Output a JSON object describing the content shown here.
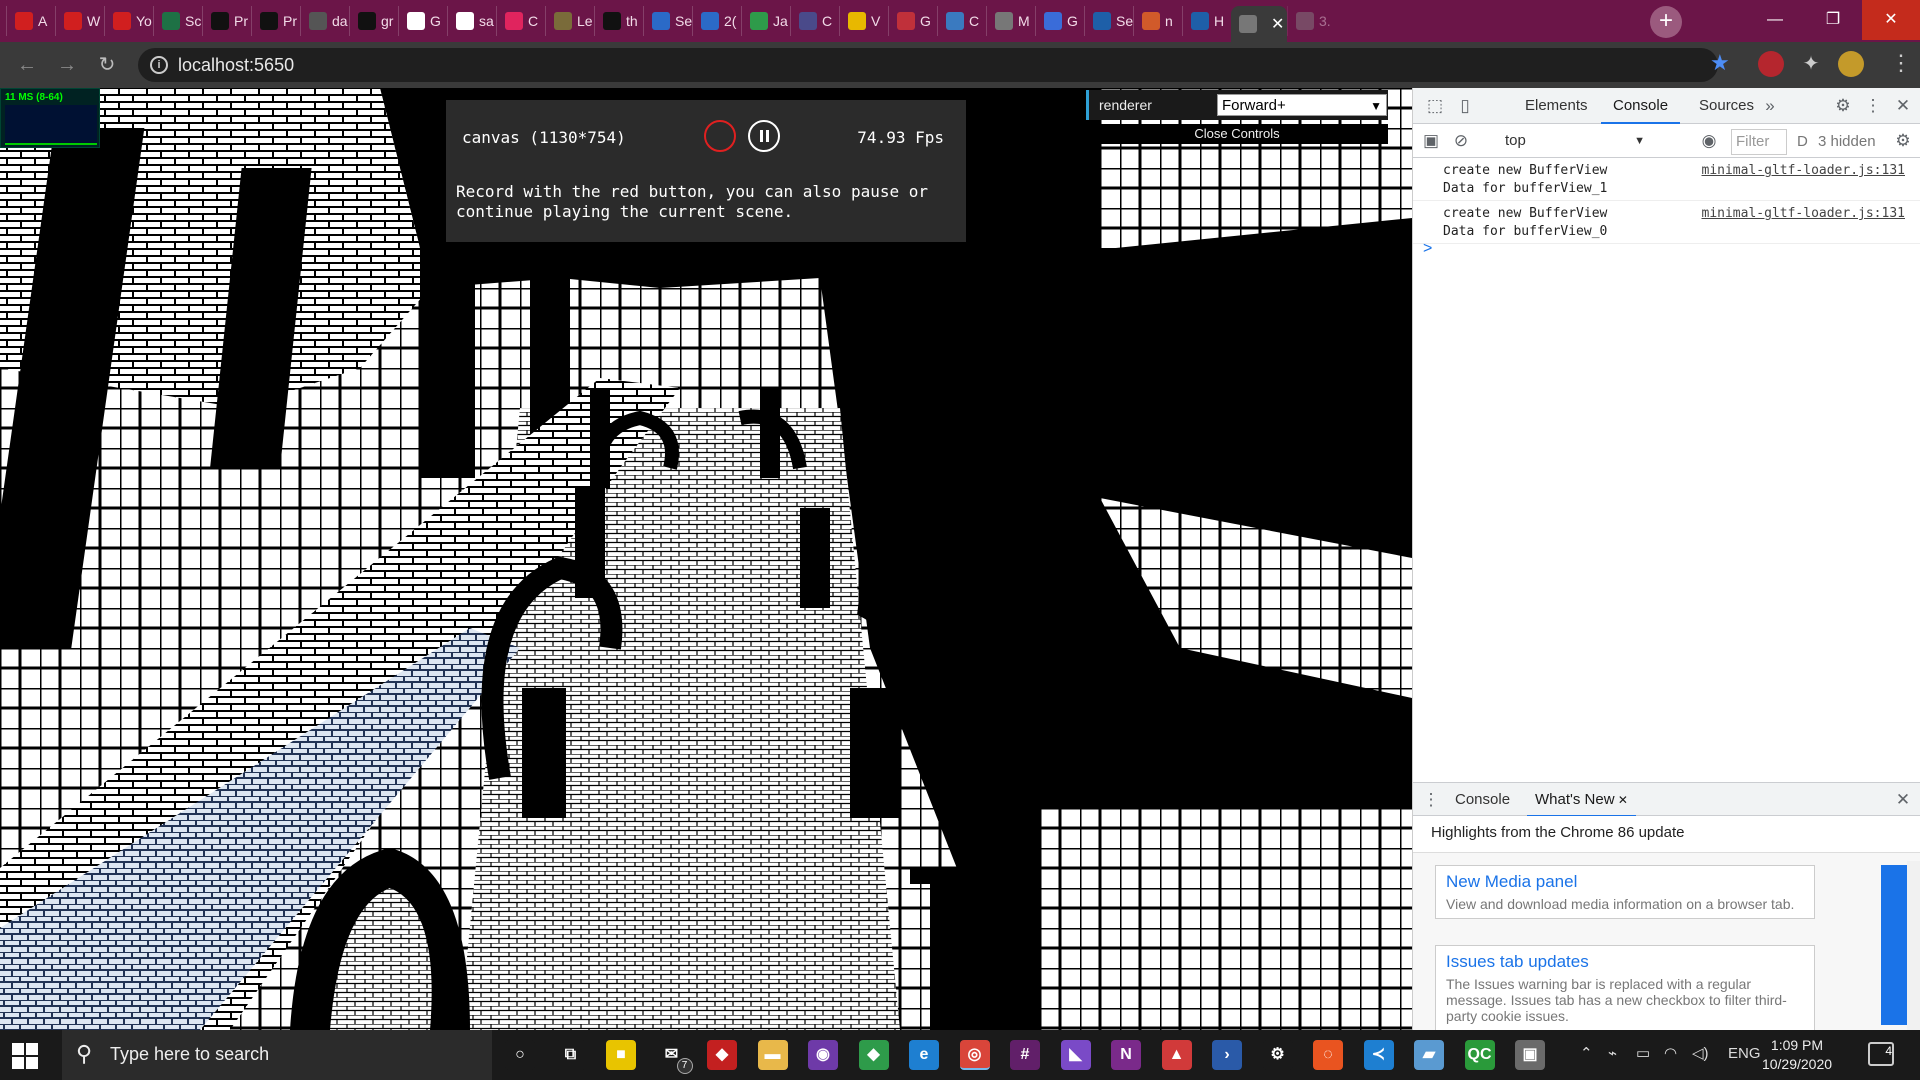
{
  "browser": {
    "tabs": [
      {
        "label": "A",
        "fav": "maple-leaf",
        "color": "#d11f1f"
      },
      {
        "label": "W",
        "fav": "maple-leaf",
        "color": "#d11f1f"
      },
      {
        "label": "Yo",
        "fav": "maple-leaf",
        "color": "#d11f1f"
      },
      {
        "label": "Sc",
        "fav": "excel",
        "color": "#1e7145"
      },
      {
        "label": "Pr",
        "fav": "github",
        "color": "#111111"
      },
      {
        "label": "Pr",
        "fav": "github",
        "color": "#111111"
      },
      {
        "label": "da",
        "fav": "globe",
        "color": "#555555"
      },
      {
        "label": "gr",
        "fav": "github",
        "color": "#111111"
      },
      {
        "label": "G",
        "fav": "google",
        "color": "#ffffff"
      },
      {
        "label": "sa",
        "fav": "google",
        "color": "#ffffff"
      },
      {
        "label": "C",
        "fav": "red-ring",
        "color": "#e0245e"
      },
      {
        "label": "Le",
        "fav": "s-stamp",
        "color": "#7a6b3a"
      },
      {
        "label": "th",
        "fav": "github",
        "color": "#111111"
      },
      {
        "label": "Se",
        "fav": "w-word",
        "color": "#2b6ac7"
      },
      {
        "label": "2(",
        "fav": "w-word",
        "color": "#2b6ac7"
      },
      {
        "label": "Ja",
        "fav": "green-box",
        "color": "#2e9b4a"
      },
      {
        "label": "C",
        "fav": "compass",
        "color": "#4a4a8a"
      },
      {
        "label": "V",
        "fav": "yellow-box",
        "color": "#e8b800"
      },
      {
        "label": "G",
        "fav": "p-red",
        "color": "#c0303a"
      },
      {
        "label": "C",
        "fav": "p-blue",
        "color": "#3a7ac0"
      },
      {
        "label": "M",
        "fav": "triangle",
        "color": "#777777"
      },
      {
        "label": "G",
        "fav": "calendar",
        "color": "#3a6cd9"
      },
      {
        "label": "Se",
        "fav": "x-blue",
        "color": "#1e5fa8"
      },
      {
        "label": "n",
        "fav": "fire",
        "color": "#d15a2a"
      },
      {
        "label": "H",
        "fav": "infinity",
        "color": "#1e5fa8"
      },
      {
        "label": "",
        "fav": "globe",
        "color": "#777777",
        "active": true
      },
      {
        "label": "3.",
        "fav": "loading",
        "color": "#888888"
      }
    ],
    "url": "localhost:5650"
  },
  "stats": {
    "label": "11 MS (8-64)"
  },
  "recorder": {
    "canvas_label": "canvas (1130*754)",
    "fps": "74.93 Fps",
    "help": "Record with the red button, you can also pause or continue playing the current scene."
  },
  "gui": {
    "label": "renderer",
    "value": "Forward+",
    "close": "Close Controls"
  },
  "devtools": {
    "tabs": [
      "Elements",
      "Console",
      "Sources"
    ],
    "active_tab": "Console",
    "context": "top",
    "filter_placeholder": "Filter",
    "levels": "D",
    "hidden": "3 hidden",
    "logs": [
      {
        "message": "create new BufferView Data for bufferView_1",
        "source": "minimal-gltf-loader.js:131"
      },
      {
        "message": "create new BufferView Data for bufferView_0",
        "source": "minimal-gltf-loader.js:131"
      }
    ],
    "prompt": ">",
    "drawer": {
      "tabs": [
        "Console",
        "What's New"
      ],
      "active_tab": "What's New",
      "highlights": "Highlights from the Chrome 86 update",
      "cards": [
        {
          "title": "New Media panel",
          "desc": "View and download media information on a browser tab."
        },
        {
          "title": "Issues tab updates",
          "desc": "The Issues warning bar is replaced with a regular message. Issues tab has a new checkbox to filter third-party cookie issues."
        }
      ]
    }
  },
  "taskbar": {
    "search_placeholder": "Type here to search",
    "mail_badge": "7",
    "lang": "ENG",
    "time": "1:09 PM",
    "date": "10/29/2020",
    "notif_count": "4",
    "apps": [
      {
        "name": "cortana",
        "glyph": "○",
        "color": "#1a1a1a"
      },
      {
        "name": "task-view",
        "glyph": "⧉",
        "color": "#1a1a1a"
      },
      {
        "name": "sticky-notes",
        "glyph": "■",
        "color": "#e8c400"
      },
      {
        "name": "mail",
        "glyph": "✉",
        "color": "#1a1a1a"
      },
      {
        "name": "game",
        "glyph": "◆",
        "color": "#c32020"
      },
      {
        "name": "explorer",
        "glyph": "▬",
        "color": "#e8b84a"
      },
      {
        "name": "github-desktop",
        "glyph": "◉",
        "color": "#6e3aa8"
      },
      {
        "name": "git",
        "glyph": "◆",
        "color": "#2e9b4a"
      },
      {
        "name": "edge",
        "glyph": "e",
        "color": "#1e7fd1"
      },
      {
        "name": "chrome",
        "glyph": "◎",
        "color": "#d9453a"
      },
      {
        "name": "slack",
        "glyph": "#",
        "color": "#611f69"
      },
      {
        "name": "vs",
        "glyph": "◣",
        "color": "#7a4ac7"
      },
      {
        "name": "onenote",
        "glyph": "N",
        "color": "#7a2a8a"
      },
      {
        "name": "arcgis",
        "glyph": "▲",
        "color": "#d13a3a"
      },
      {
        "name": "powershell",
        "glyph": "›",
        "color": "#2a5aa8"
      },
      {
        "name": "settings",
        "glyph": "⚙",
        "color": "#1a1a1a"
      },
      {
        "name": "ubuntu",
        "glyph": "◌",
        "color": "#e95420"
      },
      {
        "name": "vscode",
        "glyph": "≺",
        "color": "#1e7fd1"
      },
      {
        "name": "notepad",
        "glyph": "▰",
        "color": "#5a9ad1"
      },
      {
        "name": "qc",
        "glyph": "QC",
        "color": "#2a9a3a"
      },
      {
        "name": "device",
        "glyph": "▣",
        "color": "#6a6a6a"
      }
    ]
  }
}
